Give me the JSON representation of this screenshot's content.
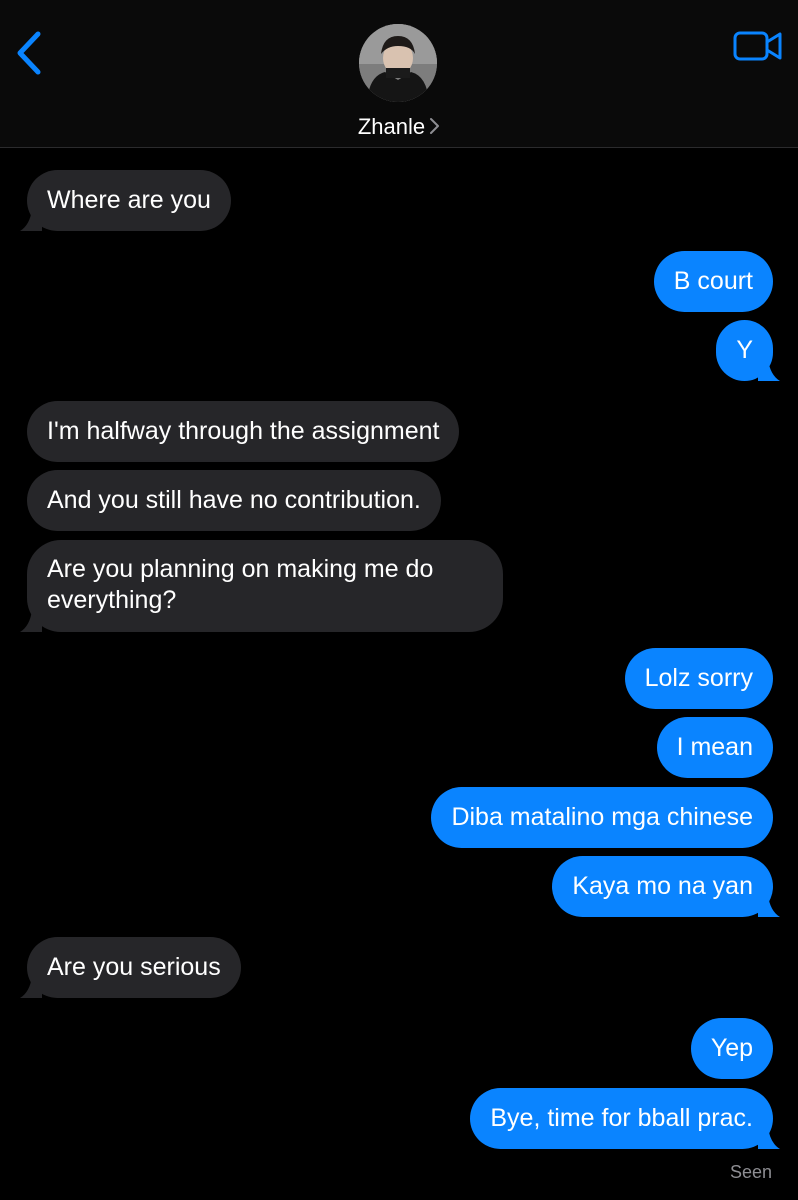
{
  "header": {
    "contact_name": "Zhanle",
    "accent_color": "#0a84ff",
    "icons": {
      "back": "chevron-left-icon",
      "video": "video-camera-icon",
      "disclosure": "chevron-right-icon"
    }
  },
  "messages": [
    {
      "from": "them",
      "text": "Where are you"
    },
    {
      "from": "me",
      "text": "B court"
    },
    {
      "from": "me",
      "text": "Y"
    },
    {
      "from": "them",
      "text": "I'm halfway through the assignment"
    },
    {
      "from": "them",
      "text": "And you still have no contribution."
    },
    {
      "from": "them",
      "text": "Are you planning on making me do everything?"
    },
    {
      "from": "me",
      "text": "Lolz sorry"
    },
    {
      "from": "me",
      "text": "I mean"
    },
    {
      "from": "me",
      "text": "Diba matalino mga chinese"
    },
    {
      "from": "me",
      "text": "Kaya mo na yan"
    },
    {
      "from": "them",
      "text": "Are you serious"
    },
    {
      "from": "me",
      "text": "Yep"
    },
    {
      "from": "me",
      "text": "Bye, time for bball prac."
    }
  ],
  "status": {
    "read_receipt": "Seen"
  },
  "colors": {
    "incoming_bubble": "#262629",
    "outgoing_bubble": "#0a84ff",
    "background": "#000000"
  }
}
